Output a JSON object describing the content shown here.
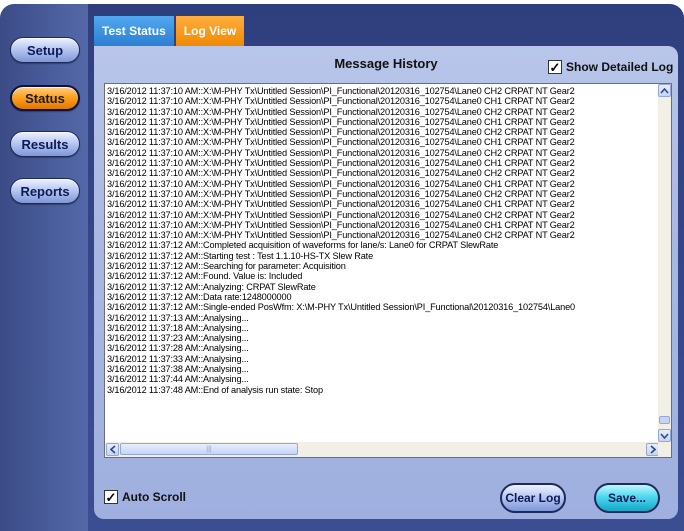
{
  "nav": {
    "setup": "Setup",
    "status": "Status",
    "results": "Results",
    "reports": "Reports"
  },
  "tabs": {
    "test_status": "Test Status",
    "log_view": "Log View"
  },
  "panel": {
    "title": "Message History",
    "show_detailed_log": "Show Detailed Log",
    "show_detailed_checked": "✓",
    "auto_scroll": "Auto Scroll",
    "auto_scroll_checked": "✓",
    "clear_log": "Clear Log",
    "save": "Save..."
  },
  "log": [
    "3/16/2012 11:37:10 AM::X:\\M-PHY Tx\\Untitled Session\\PI_Functional\\20120316_102754\\Lane0 CH2 CRPAT NT Gear2",
    "3/16/2012 11:37:10 AM::X:\\M-PHY Tx\\Untitled Session\\PI_Functional\\20120316_102754\\Lane0 CH1 CRPAT NT Gear2",
    "3/16/2012 11:37:10 AM::X:\\M-PHY Tx\\Untitled Session\\PI_Functional\\20120316_102754\\Lane0 CH2 CRPAT NT Gear2",
    "3/16/2012 11:37:10 AM::X:\\M-PHY Tx\\Untitled Session\\PI_Functional\\20120316_102754\\Lane0 CH1 CRPAT NT Gear2",
    "3/16/2012 11:37:10 AM::X:\\M-PHY Tx\\Untitled Session\\PI_Functional\\20120316_102754\\Lane0 CH2 CRPAT NT Gear2",
    "3/16/2012 11:37:10 AM::X:\\M-PHY Tx\\Untitled Session\\PI_Functional\\20120316_102754\\Lane0 CH1 CRPAT NT Gear2",
    "3/16/2012 11:37:10 AM::X:\\M-PHY Tx\\Untitled Session\\PI_Functional\\20120316_102754\\Lane0 CH2 CRPAT NT Gear2",
    "3/16/2012 11:37:10 AM::X:\\M-PHY Tx\\Untitled Session\\PI_Functional\\20120316_102754\\Lane0 CH1 CRPAT NT Gear2",
    "3/16/2012 11:37:10 AM::X:\\M-PHY Tx\\Untitled Session\\PI_Functional\\20120316_102754\\Lane0 CH2 CRPAT NT Gear2",
    "3/16/2012 11:37:10 AM::X:\\M-PHY Tx\\Untitled Session\\PI_Functional\\20120316_102754\\Lane0 CH1 CRPAT NT Gear2",
    "3/16/2012 11:37:10 AM::X:\\M-PHY Tx\\Untitled Session\\PI_Functional\\20120316_102754\\Lane0 CH2 CRPAT NT Gear2",
    "3/16/2012 11:37:10 AM::X:\\M-PHY Tx\\Untitled Session\\PI_Functional\\20120316_102754\\Lane0 CH1 CRPAT NT Gear2",
    "3/16/2012 11:37:10 AM::X:\\M-PHY Tx\\Untitled Session\\PI_Functional\\20120316_102754\\Lane0 CH2 CRPAT NT Gear2",
    "3/16/2012 11:37:10 AM::X:\\M-PHY Tx\\Untitled Session\\PI_Functional\\20120316_102754\\Lane0 CH1 CRPAT NT Gear2",
    "3/16/2012 11:37:10 AM::X:\\M-PHY Tx\\Untitled Session\\PI_Functional\\20120316_102754\\Lane0 CH2 CRPAT NT Gear2",
    "3/16/2012 11:37:12 AM::Completed acquisition of waveforms for lane/s: Lane0 for CRPAT SlewRate",
    "3/16/2012 11:37:12 AM::Starting test : Test 1.1.10-HS-TX Slew Rate",
    "3/16/2012 11:37:12 AM::Searching for parameter: Acquisition",
    "3/16/2012 11:37:12 AM::Found. Value is: Included",
    "3/16/2012 11:37:12 AM::Analyzing: CRPAT SlewRate",
    "3/16/2012 11:37:12 AM::Data rate:1248000000",
    "3/16/2012 11:37:12 AM::Single-ended PosWfm: X:\\M-PHY Tx\\Untitled Session\\PI_Functional\\20120316_102754\\Lane0",
    "3/16/2012 11:37:13 AM::Analysing...",
    "3/16/2012 11:37:18 AM::Analysing...",
    "3/16/2012 11:37:23 AM::Analysing...",
    "3/16/2012 11:37:28 AM::Analysing...",
    "3/16/2012 11:37:33 AM::Analysing...",
    "3/16/2012 11:37:38 AM::Analysing...",
    "3/16/2012 11:37:44 AM::Analysing...",
    "3/16/2012 11:37:48 AM::End of analysis run state: Stop"
  ]
}
